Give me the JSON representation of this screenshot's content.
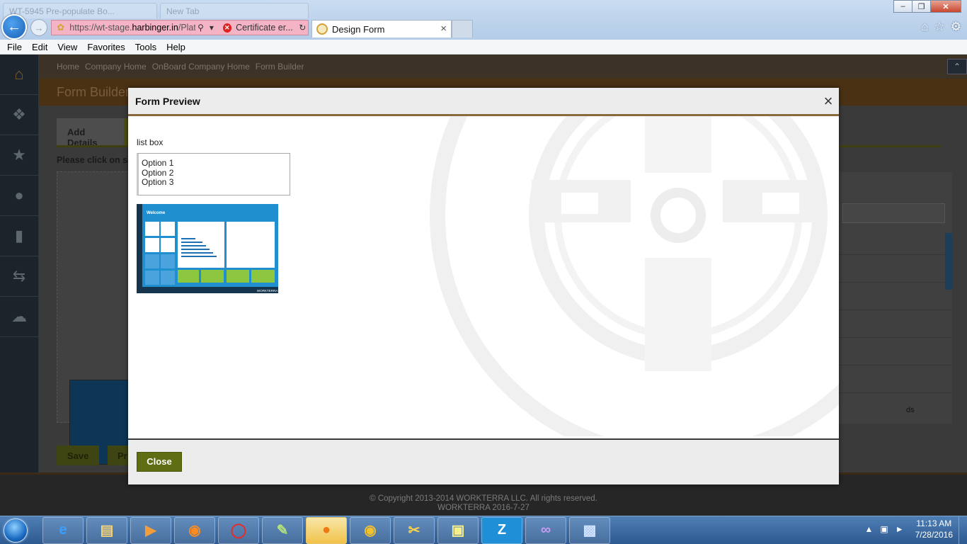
{
  "browser": {
    "bg_tabs": [
      "WT-5945 Pre-populate Bo...",
      "New Tab"
    ],
    "address": {
      "url_prefix": "https://wt-stage.",
      "url_domain": "harbinger.in",
      "url_suffix": "/Platf",
      "cert_error": "Certificate er..."
    },
    "active_tab": {
      "title": "Design Form",
      "close": "×"
    },
    "window_buttons": {
      "minimize": "–",
      "maximize": "❐",
      "close": "✕"
    },
    "menu": [
      "File",
      "Edit",
      "View",
      "Favorites",
      "Tools",
      "Help"
    ],
    "icons": [
      "home-icon",
      "favorites-star-icon",
      "settings-gear-icon"
    ]
  },
  "app": {
    "breadcrumb": [
      "Home",
      "Company Home",
      "OnBoard Company Home",
      "Form Builder"
    ],
    "page_title": "Form Builder",
    "add_details_tab": "Add Details",
    "instruction": "Please click on save",
    "right_panel_text": "ds",
    "save_label": "Save",
    "preview_label": "Pr",
    "sidebar_icons": [
      "home-icon",
      "puzzle-icon",
      "user-star-icon",
      "user-icon",
      "bar-chart-icon",
      "transfer-icon",
      "chat-icon"
    ],
    "footer": {
      "copyright": "© Copyright 2013-2014 WORKTERRA LLC. All rights reserved.",
      "version": "WORKTERRA 2016-7-27"
    }
  },
  "modal": {
    "title": "Form Preview",
    "close_x": "×",
    "field_label": "list box",
    "listbox_options": [
      "Option 1",
      "Option 2",
      "Option 3"
    ],
    "preview_image": {
      "welcome": "Welcome",
      "brand": "WORKTERRA"
    },
    "close_button": "Close"
  },
  "taskbar": {
    "apps": [
      "internet-explorer-icon",
      "file-explorer-icon",
      "media-player-icon",
      "firefox-icon",
      "opera-icon",
      "notepad-plus-icon",
      "flame-app-icon",
      "chrome-icon",
      "snipping-tool-icon",
      "sticky-notes-icon",
      "zoomit-icon",
      "visual-studio-icon",
      "remote-desktop-icon"
    ],
    "zoom_letter": "Z",
    "time": "11:13 AM",
    "date": "7/28/2016"
  }
}
